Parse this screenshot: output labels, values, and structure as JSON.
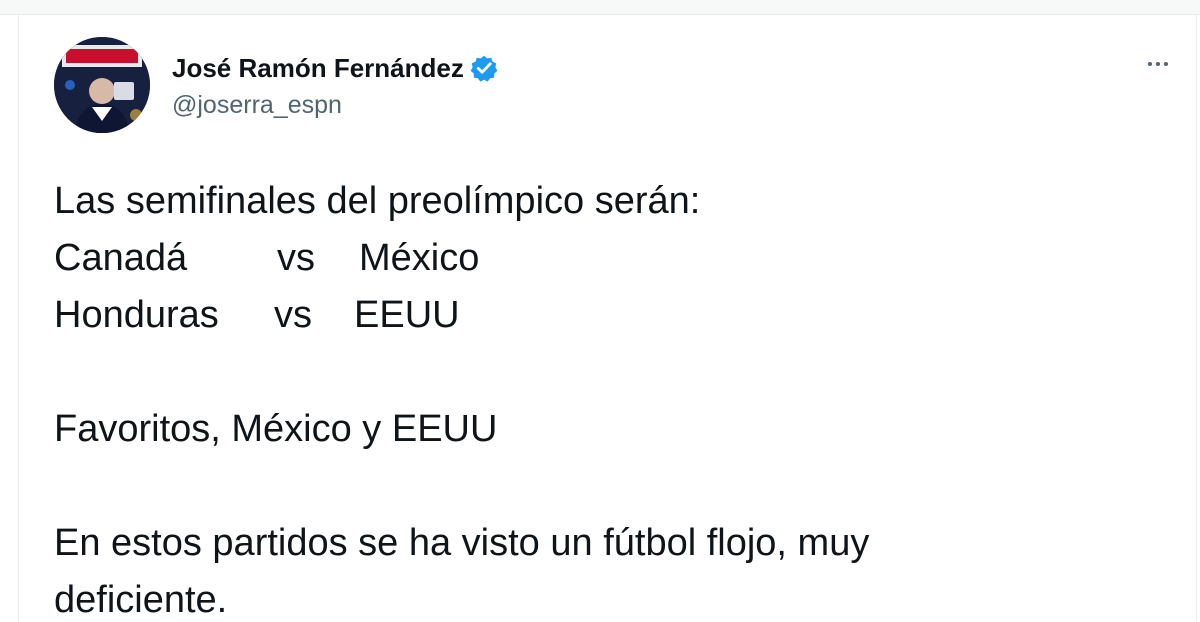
{
  "user": {
    "display_name": "José Ramón Fernández",
    "handle": "@joserra_espn",
    "verified": true,
    "avatar_icon": "profile-photo-icon"
  },
  "tweet": {
    "intro": "Las semifinales del preolímpico serán:",
    "matches": [
      {
        "home": "Canadá",
        "vs": "vs",
        "away": "México"
      },
      {
        "home": "Honduras",
        "vs": "vs",
        "away": "EEUU"
      }
    ],
    "favorites": "Favoritos, México y EEUU",
    "closing_line1": "En estos partidos se ha visto un fútbol flojo, muy",
    "closing_line2": "deficiente."
  },
  "colors": {
    "text": "#0f1419",
    "secondary": "#536471",
    "verified_badge": "#1d9bf0"
  }
}
